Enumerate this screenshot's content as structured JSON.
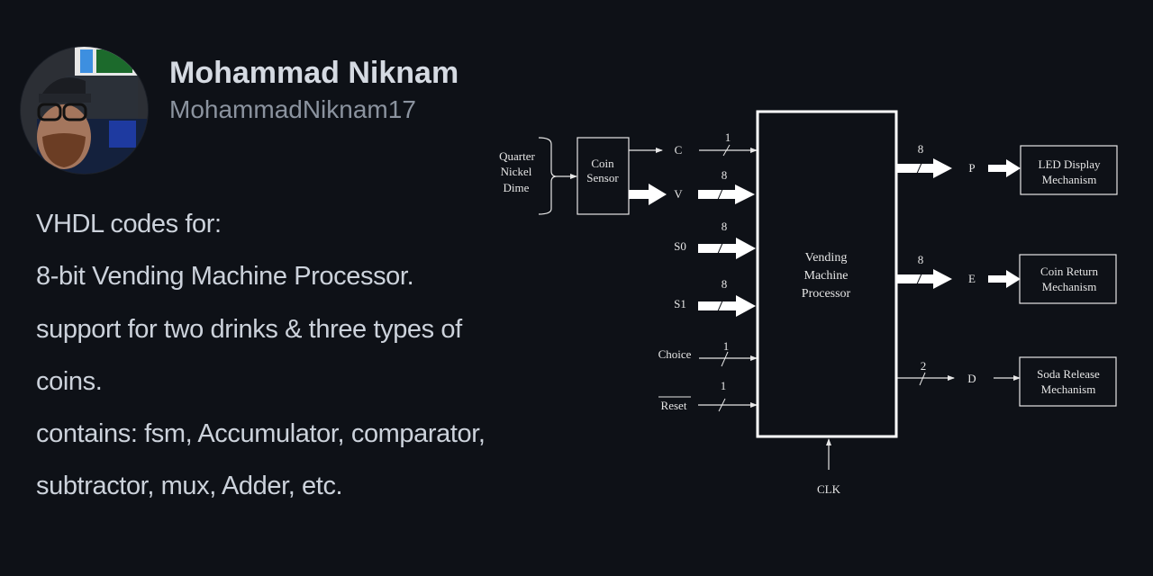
{
  "profile": {
    "name": "Mohammad Niknam",
    "handle": "MohammadNiknam17",
    "avatar_icon": "user-photo"
  },
  "description": {
    "lines": [
      "VHDL codes for:",
      "8-bit Vending Machine Processor.",
      "support for two drinks & three types of",
      "coins.",
      "contains: fsm, Accumulator, comparator,",
      "subtractor, mux, Adder, etc."
    ]
  },
  "diagram": {
    "coin_inputs": [
      "Quarter",
      "Nickel",
      "Dime"
    ],
    "coin_sensor": [
      "Coin",
      "Sensor"
    ],
    "processor": [
      "Vending",
      "Machine",
      "Processor"
    ],
    "inputs": [
      {
        "name": "C",
        "width": "1",
        "bus": false
      },
      {
        "name": "V",
        "width": "8",
        "bus": true
      },
      {
        "name": "S0",
        "width": "8",
        "bus": true
      },
      {
        "name": "S1",
        "width": "8",
        "bus": true
      },
      {
        "name": "Choice",
        "width": "1",
        "bus": false
      },
      {
        "name": "Reset",
        "width": "1",
        "bus": false,
        "active_low": true
      }
    ],
    "clock": "CLK",
    "outputs": [
      {
        "name": "P",
        "width": "8",
        "bus": true,
        "target": [
          "LED Display",
          "Mechanism"
        ]
      },
      {
        "name": "E",
        "width": "8",
        "bus": true,
        "target": [
          "Coin Return",
          "Mechanism"
        ]
      },
      {
        "name": "D",
        "width": "2",
        "bus": false,
        "target": [
          "Soda Release",
          "Mechanism"
        ]
      }
    ]
  }
}
